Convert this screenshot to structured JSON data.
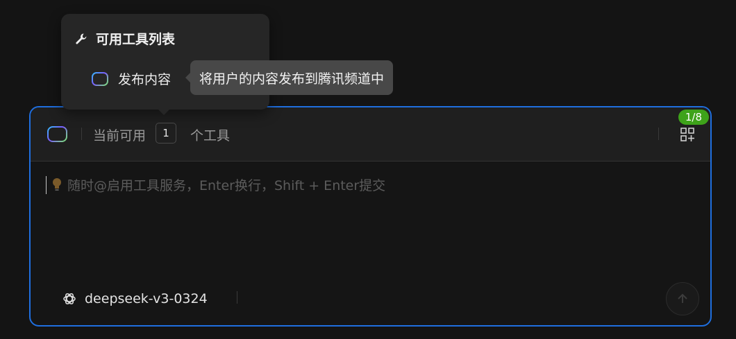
{
  "popover": {
    "title": "可用工具列表",
    "title_icon": "wrench-icon",
    "tools": [
      {
        "label": "发布内容",
        "icon": "tool-ring-icon"
      }
    ]
  },
  "tooltip": {
    "text": "将用户的内容发布到腾讯频道中"
  },
  "composer": {
    "tools_prefix": "当前可用",
    "tools_count": "1",
    "tools_suffix": "个工具",
    "page_badge": "1/8",
    "grid_icon": "apps-grid-icon",
    "placeholder": "随时@启用工具服务，Enter换行，Shift + Enter提交",
    "placeholder_icon": "lightbulb-icon",
    "model": "deepseek-v3-0324",
    "model_icon": "openai-icon",
    "send_icon": "arrow-up-icon"
  },
  "colors": {
    "accent_border": "#1f6fe0",
    "badge_green": "#3ea31a",
    "background": "#141414"
  }
}
